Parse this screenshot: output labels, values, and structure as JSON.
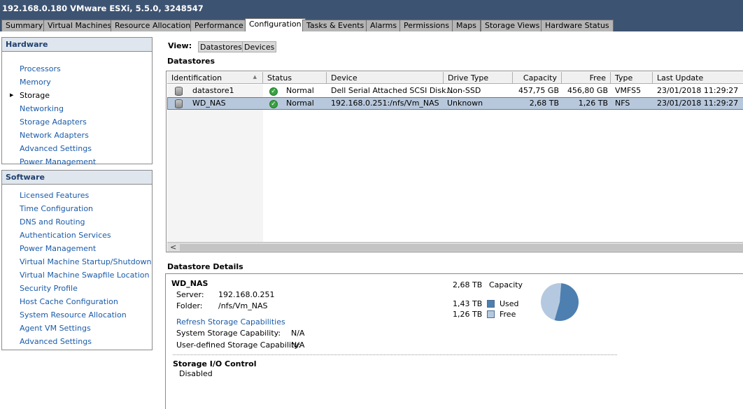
{
  "window": {
    "title": "192.168.0.180 VMware ESXi, 5.5.0, 3248547"
  },
  "tabs": [
    {
      "label": "Summary"
    },
    {
      "label": "Virtual Machines"
    },
    {
      "label": "Resource Allocation"
    },
    {
      "label": "Performance"
    },
    {
      "label": "Configuration"
    },
    {
      "label": "Tasks & Events"
    },
    {
      "label": "Alarms"
    },
    {
      "label": "Permissions"
    },
    {
      "label": "Maps"
    },
    {
      "label": "Storage Views"
    },
    {
      "label": "Hardware Status"
    }
  ],
  "active_tab": "Configuration",
  "hardware": {
    "header": "Hardware",
    "items": [
      {
        "label": "Processors"
      },
      {
        "label": "Memory"
      },
      {
        "label": "Storage"
      },
      {
        "label": "Networking"
      },
      {
        "label": "Storage Adapters"
      },
      {
        "label": "Network Adapters"
      },
      {
        "label": "Advanced Settings"
      },
      {
        "label": "Power Management"
      }
    ],
    "selected": "Storage"
  },
  "software": {
    "header": "Software",
    "items": [
      {
        "label": "Licensed Features"
      },
      {
        "label": "Time Configuration"
      },
      {
        "label": "DNS and Routing"
      },
      {
        "label": "Authentication Services"
      },
      {
        "label": "Power Management"
      },
      {
        "label": "Virtual Machine Startup/Shutdown"
      },
      {
        "label": "Virtual Machine Swapfile Location"
      },
      {
        "label": "Security Profile"
      },
      {
        "label": "Host Cache Configuration"
      },
      {
        "label": "System Resource Allocation"
      },
      {
        "label": "Agent VM Settings"
      },
      {
        "label": "Advanced Settings"
      }
    ]
  },
  "view": {
    "label": "View:",
    "buttons": [
      {
        "label": "Datastores"
      },
      {
        "label": "Devices"
      }
    ],
    "selected": "Datastores"
  },
  "datastores": {
    "title": "Datastores",
    "columns": [
      "Identification",
      "Status",
      "Device",
      "Drive Type",
      "Capacity",
      "Free",
      "Type",
      "Last Update"
    ],
    "rows": [
      {
        "identification": "datastore1",
        "status": "Normal",
        "device": "Dell Serial Attached SCSI Disk...",
        "drive_type": "Non-SSD",
        "capacity": "457,75 GB",
        "free": "456,80 GB",
        "type": "VMFS5",
        "last_update": "23/01/2018 11:29:27",
        "selected": false
      },
      {
        "identification": "WD_NAS",
        "status": "Normal",
        "device": "192.168.0.251:/nfs/Vm_NAS",
        "drive_type": "Unknown",
        "capacity": "2,68 TB",
        "free": "1,26 TB",
        "type": "NFS",
        "last_update": "23/01/2018 11:29:27",
        "selected": true
      }
    ],
    "sort_indicator": "▲",
    "scroll_left_arrow": "<"
  },
  "details": {
    "title": "Datastore Details",
    "name": "WD_NAS",
    "server_label": "Server:",
    "server_value": "192.168.0.251",
    "folder_label": "Folder:",
    "folder_value": "/nfs/Vm_NAS",
    "refresh_link": "Refresh Storage Capabilities",
    "system_cap_label": "System Storage Capability:",
    "system_cap_value": "N/A",
    "user_cap_label": "User-defined Storage Capability:",
    "user_cap_value": "N/A",
    "capacity_value": "2,68 TB",
    "capacity_label": "Capacity",
    "used_value": "1,43 TB",
    "used_label": "Used",
    "free_value": "1,26 TB",
    "free_label": "Free",
    "pie": {
      "used": 1.43,
      "free": 1.26
    },
    "used_color": "#4d7fb0",
    "free_color": "#b4c9e0",
    "sioc_title": "Storage I/O Control",
    "sioc_value": "Disabled"
  },
  "colors": {
    "titlebar": "#3d5372",
    "link": "#1a5ba8",
    "selected_row": "#b8c8dc",
    "status_ok": "#3aa142"
  }
}
